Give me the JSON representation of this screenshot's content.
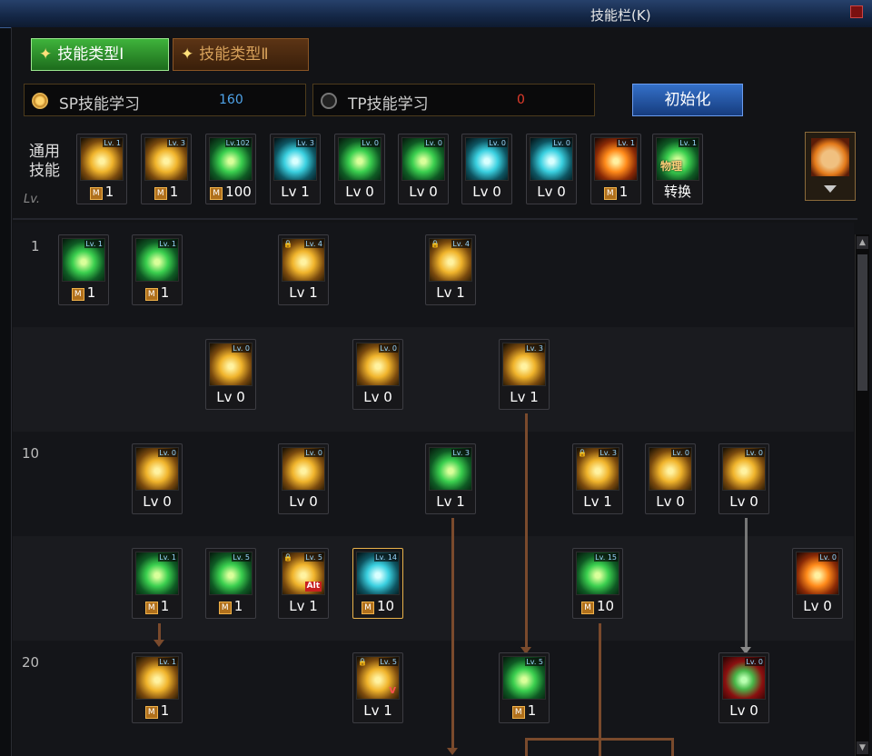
{
  "window": {
    "title": "技能栏(K)"
  },
  "tabs": [
    {
      "label": "技能类型Ⅰ"
    },
    {
      "label": "技能类型Ⅱ"
    }
  ],
  "sp": {
    "label": "SP技能学习",
    "value": "160"
  },
  "tp": {
    "label": "TP技能学习",
    "value": "0"
  },
  "reset_label": "初始化",
  "common": {
    "label": "通用技能",
    "lv_label": "Lv.",
    "skills": [
      {
        "badge": "Lv. 1",
        "value": "1",
        "mastered": true,
        "color": "y"
      },
      {
        "badge": "Lv. 3",
        "value": "1",
        "mastered": true,
        "color": "y"
      },
      {
        "badge": "Lv.102",
        "value": "100",
        "mastered": true,
        "color": "g"
      },
      {
        "badge": "Lv. 3",
        "value": "Lv 1",
        "mastered": false,
        "color": "c"
      },
      {
        "badge": "Lv. 0",
        "value": "Lv 0",
        "mastered": false,
        "color": "g"
      },
      {
        "badge": "Lv. 0",
        "value": "Lv 0",
        "mastered": false,
        "color": "g"
      },
      {
        "badge": "Lv. 0",
        "value": "Lv 0",
        "mastered": false,
        "color": "c"
      },
      {
        "badge": "Lv. 0",
        "value": "Lv 0",
        "mastered": false,
        "color": "c"
      },
      {
        "badge": "Lv. 1",
        "value": "1",
        "mastered": true,
        "color": "o"
      },
      {
        "badge": "Lv. 1",
        "value": "转换",
        "mastered": false,
        "color": "g",
        "overlay": "物理"
      }
    ]
  },
  "row_labels": {
    "r1": "1",
    "r10": "10",
    "r20": "20"
  },
  "tree": [
    {
      "badge": "Lv. 1",
      "value": "1",
      "mastered": true,
      "color": "g"
    },
    {
      "badge": "Lv. 1",
      "value": "1",
      "mastered": true,
      "color": "g"
    },
    {
      "badge": "Lv. 4",
      "value": "Lv 1",
      "mastered": false,
      "color": "y",
      "locked": true
    },
    {
      "badge": "Lv. 4",
      "value": "Lv 1",
      "mastered": false,
      "color": "y",
      "locked": true
    },
    {
      "badge": "Lv. 0",
      "value": "Lv 0",
      "mastered": false,
      "color": "y"
    },
    {
      "badge": "Lv. 0",
      "value": "Lv 0",
      "mastered": false,
      "color": "y"
    },
    {
      "badge": "Lv. 3",
      "value": "Lv 1",
      "mastered": false,
      "color": "y"
    },
    {
      "badge": "Lv. 0",
      "value": "Lv 0",
      "mastered": false,
      "color": "y"
    },
    {
      "badge": "Lv. 0",
      "value": "Lv 0",
      "mastered": false,
      "color": "y"
    },
    {
      "badge": "Lv. 3",
      "value": "Lv 1",
      "mastered": false,
      "color": "g"
    },
    {
      "badge": "Lv. 3",
      "value": "Lv 1",
      "mastered": false,
      "color": "y",
      "locked": true
    },
    {
      "badge": "Lv. 0",
      "value": "Lv 0",
      "mastered": false,
      "color": "y"
    },
    {
      "badge": "Lv. 0",
      "value": "Lv 0",
      "mastered": false,
      "color": "y"
    },
    {
      "badge": "Lv. 1",
      "value": "1",
      "mastered": true,
      "color": "g"
    },
    {
      "badge": "Lv. 5",
      "value": "1",
      "mastered": true,
      "color": "g"
    },
    {
      "badge": "Lv. 5",
      "value": "Lv 1",
      "mastered": false,
      "color": "y",
      "locked": true,
      "tag": "Alt"
    },
    {
      "badge": "Lv. 14",
      "value": "10",
      "mastered": true,
      "color": "c"
    },
    {
      "badge": "Lv. 15",
      "value": "10",
      "mastered": true,
      "color": "g"
    },
    {
      "badge": "Lv. 0",
      "value": "Lv 0",
      "mastered": false,
      "color": "o"
    },
    {
      "badge": "Lv. 1",
      "value": "1",
      "mastered": true,
      "color": "y"
    },
    {
      "badge": "Lv. 5",
      "value": "Lv 1",
      "mastered": false,
      "color": "y",
      "locked": true,
      "tag": "V"
    },
    {
      "badge": "Lv. 5",
      "value": "1",
      "mastered": true,
      "color": "g"
    },
    {
      "badge": "Lv. 0",
      "value": "Lv 0",
      "mastered": false,
      "color": "r"
    }
  ]
}
